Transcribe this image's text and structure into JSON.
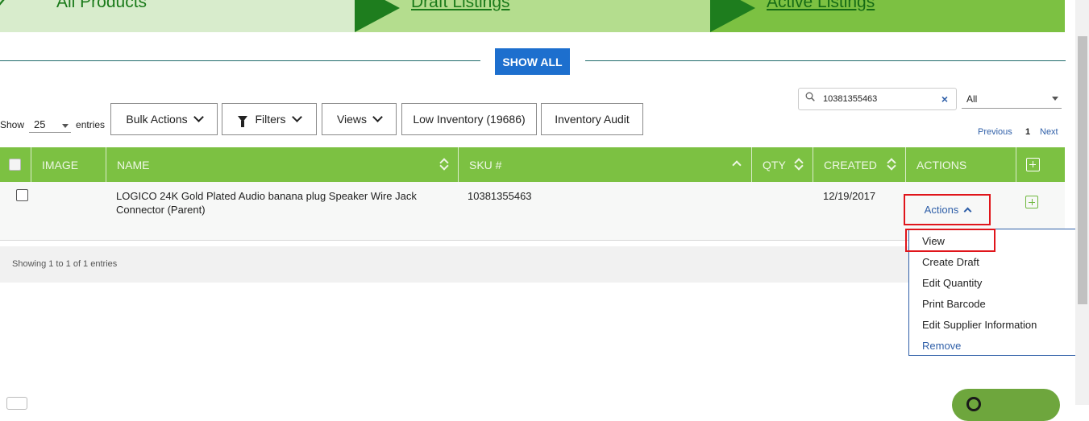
{
  "tabs": [
    {
      "label": "All Products"
    },
    {
      "label": "Draft Listings"
    },
    {
      "label": "Active Listings"
    }
  ],
  "show_all_label": "SHOW ALL",
  "search": {
    "value": "10381355463",
    "clear_glyph": "×",
    "scope": "All"
  },
  "toolbar": {
    "show_label": "Show",
    "entries_value": "25",
    "entries_label": "entries",
    "bulk_actions": "Bulk Actions",
    "filters": "Filters",
    "views": "Views",
    "low_inventory": "Low Inventory (19686)",
    "inventory_audit": "Inventory Audit"
  },
  "pager": {
    "previous": "Previous",
    "page": "1",
    "next": "Next"
  },
  "table": {
    "headers": {
      "image": "IMAGE",
      "name": "NAME",
      "sku": "SKU #",
      "qty": "QTY",
      "created": "CREATED",
      "actions": "ACTIONS"
    },
    "rows": [
      {
        "name": "LOGICO 24K Gold Plated Audio banana plug Speaker Wire Jack Connector (Parent)",
        "sku": "10381355463",
        "qty": "",
        "created": "12/19/2017",
        "actions_label": "Actions"
      }
    ],
    "footer": "Showing 1 to 1 of 1 entries"
  },
  "actions_menu": [
    "View",
    "Create Draft",
    "Edit Quantity",
    "Print Barcode",
    "Edit Supplier Information",
    "Remove"
  ],
  "colors": {
    "green": "#7cc142",
    "dark_green": "#1e7d1e",
    "blue": "#1d6fce",
    "link": "#2f5fa8",
    "highlight": "#e0151b"
  },
  "icons": [
    "check-icon",
    "search-icon",
    "close-icon",
    "chevron-down-icon",
    "filter-icon",
    "sort-icon",
    "chevron-up-icon",
    "plus-square-icon"
  ]
}
